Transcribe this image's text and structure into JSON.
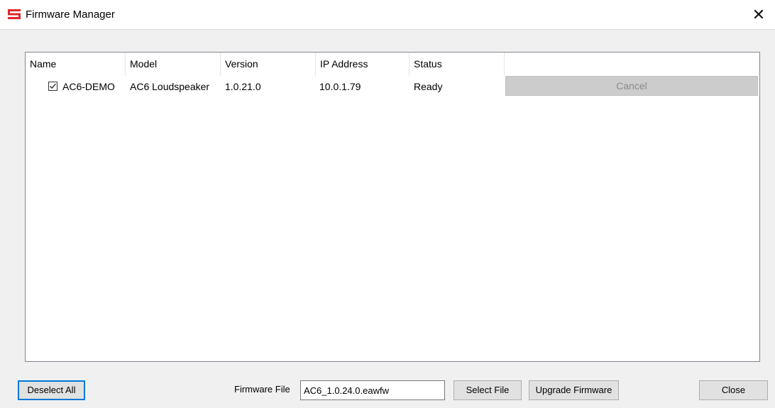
{
  "window": {
    "title": "Firmware Manager",
    "close_glyph": "✕",
    "icon": "app-logo-icon",
    "accent_color": "#e0282d"
  },
  "table": {
    "columns": [
      "Name",
      "Model",
      "Version",
      "IP Address",
      "Status"
    ],
    "rows": [
      {
        "checked": true,
        "name": "AC6-DEMO",
        "model": "AC6 Loudspeaker",
        "version": "1.0.21.0",
        "ip": "10.0.1.79",
        "status": "Ready",
        "action_label": "Cancel",
        "action_enabled": false
      }
    ]
  },
  "footer": {
    "deselect_all_label": "Deselect All",
    "firmware_file_label": "Firmware File",
    "firmware_file_value": "AC6_1.0.24.0.eawfw",
    "select_file_label": "Select File",
    "upgrade_label": "Upgrade Firmware",
    "close_label": "Close"
  }
}
